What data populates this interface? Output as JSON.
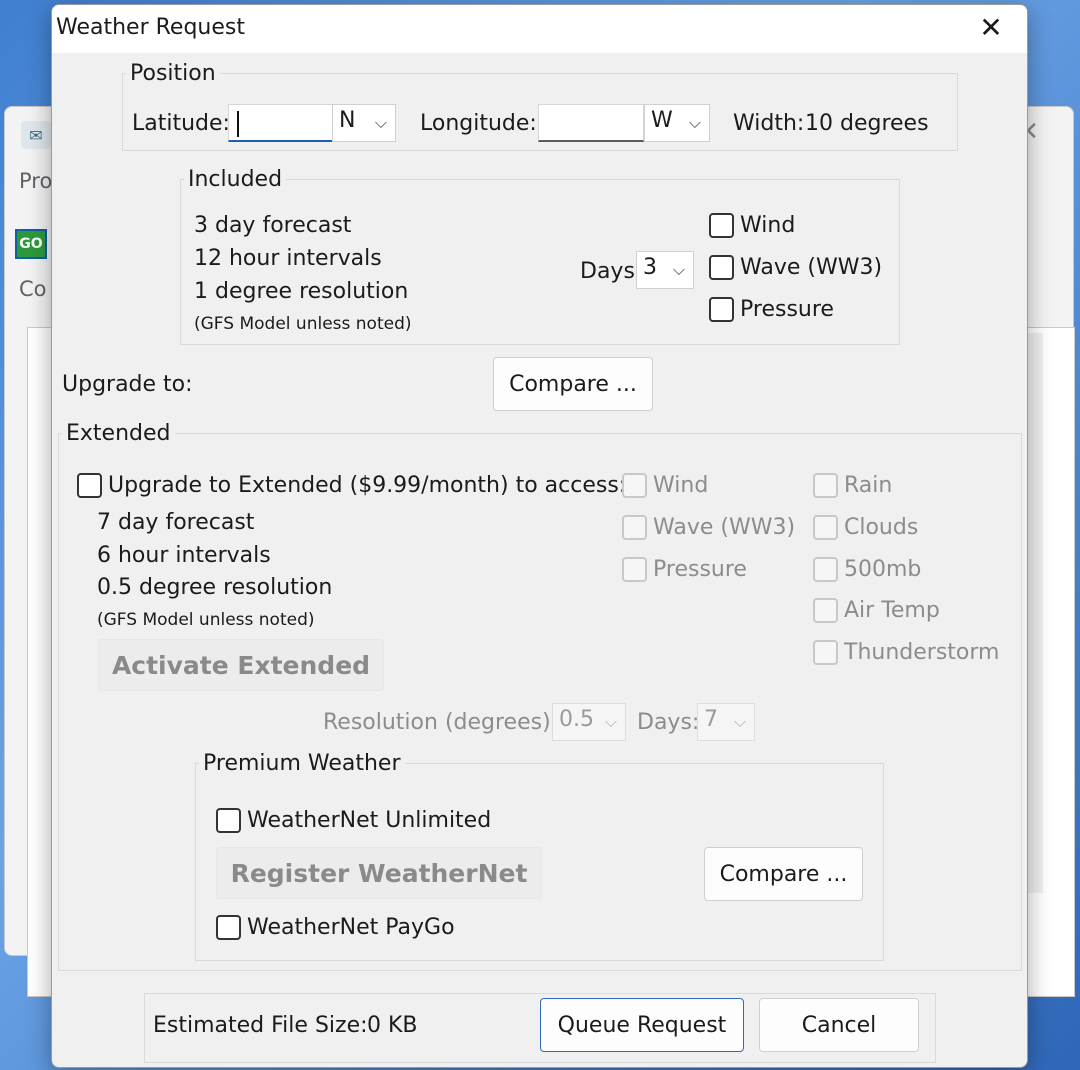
{
  "background": {
    "partial_texts": [
      "Pro",
      "Co"
    ],
    "go_badge": "GO"
  },
  "dialog": {
    "title": "Weather Request",
    "close_glyph": "✕"
  },
  "position": {
    "group_label": "Position",
    "latitude_label": "Latitude:",
    "latitude_value": "",
    "lat_dir": "N",
    "longitude_label": "Longitude:",
    "longitude_value": "",
    "lon_dir": "W",
    "width_label": "Width:",
    "width_value": "10 degrees"
  },
  "included": {
    "group_label": "Included",
    "lines": [
      "3 day forecast",
      "12 hour intervals",
      "1 degree resolution"
    ],
    "note": "(GFS Model unless noted)",
    "days_label": "Days:",
    "days_value": "3",
    "options": [
      {
        "label": "Wind",
        "checked": false
      },
      {
        "label": "Wave (WW3)",
        "checked": false
      },
      {
        "label": "Pressure",
        "checked": false
      }
    ]
  },
  "upgrade": {
    "label": "Upgrade to:",
    "compare_label": "Compare ..."
  },
  "extended": {
    "group_label": "Extended",
    "upgrade_checkbox_label": "Upgrade to Extended ($9.99/month) to access:",
    "lines": [
      "7 day forecast",
      "6 hour intervals",
      "0.5 degree resolution"
    ],
    "note": "(GFS Model unless noted)",
    "activate_label": "Activate Extended",
    "col1": [
      "Wind",
      "Wave (WW3)",
      "Pressure"
    ],
    "col2": [
      "Rain",
      "Clouds",
      "500mb",
      "Air Temp",
      "Thunderstorm"
    ],
    "resolution_label": "Resolution (degrees):",
    "resolution_value": "0.5",
    "days_label": "Days:",
    "days_value": "7"
  },
  "premium": {
    "group_label": "Premium Weather",
    "unlimited_label": "WeatherNet Unlimited",
    "register_label": "Register WeatherNet",
    "compare_label": "Compare ...",
    "paygo_label": "WeatherNet PayGo"
  },
  "footer": {
    "file_size_label": "Estimated File Size:",
    "file_size_value": "0 KB",
    "queue_label": "Queue Request",
    "cancel_label": "Cancel"
  },
  "icons": {
    "chevron": "⌵"
  }
}
